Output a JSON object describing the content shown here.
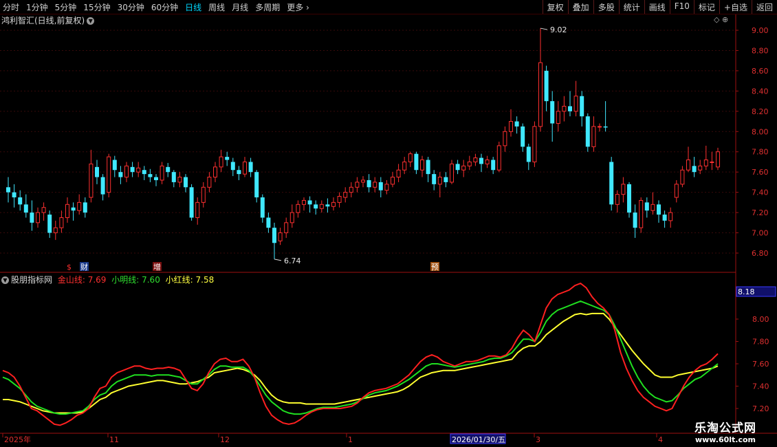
{
  "toolbar": {
    "periods": [
      "分时",
      "1分钟",
      "5分钟",
      "15分钟",
      "30分钟",
      "60分钟",
      "日线",
      "周线",
      "月线",
      "多周期",
      "更多"
    ],
    "active_period": "日线",
    "more_icon": "chevron-right-icon",
    "right_buttons": [
      "复权",
      "叠加",
      "多股",
      "统计",
      "画线",
      "F10",
      "标记",
      "+自选",
      "返回"
    ]
  },
  "stock": {
    "title": "鸿利智汇(日线,前复权)",
    "title_icon": "chevron-down-icon",
    "panel_icons": "◇ ⊕"
  },
  "indicator": {
    "icon": "chevron-down-icon",
    "name": "股朋指标网",
    "line1": "金山线: 7.69",
    "line2": "小明线: 7.60",
    "line3": "小红线: 7.58",
    "current_value": "8.18",
    "colors": {
      "jinshan": "#ff2020",
      "xiaoming": "#20e020",
      "xiaohong": "#ffff30"
    }
  },
  "chart_data": [
    {
      "type": "candlestick",
      "price_axis_ticks": [
        "9.00",
        "8.80",
        "8.60",
        "8.40",
        "8.20",
        "8.00",
        "7.80",
        "7.60",
        "7.40",
        "7.20",
        "7.00",
        "6.80"
      ],
      "ylim": [
        6.7,
        9.1
      ],
      "high_label": "9.02",
      "low_label": "6.74",
      "markers": [
        {
          "text": "$",
          "color": "#ff3030"
        },
        {
          "text": "财",
          "color": "#ffffff"
        },
        {
          "text": "增",
          "color": "#ffffff"
        },
        {
          "text": "预",
          "color": "#ffffff"
        }
      ],
      "colors": {
        "up": "#ff3030",
        "down": "#40e8ff"
      },
      "candles": [
        [
          7.45,
          7.4,
          7.55,
          7.3
        ],
        [
          7.4,
          7.35,
          7.48,
          7.25
        ],
        [
          7.35,
          7.28,
          7.42,
          7.22
        ],
        [
          7.28,
          7.2,
          7.38,
          7.15
        ],
        [
          7.2,
          7.1,
          7.32,
          7.02
        ],
        [
          7.1,
          7.2,
          7.25,
          7.05
        ],
        [
          7.2,
          7.25,
          7.3,
          7.12
        ],
        [
          7.18,
          7.0,
          7.22,
          6.95
        ],
        [
          7.0,
          7.05,
          7.12,
          6.93
        ],
        [
          7.05,
          7.15,
          7.22,
          7.0
        ],
        [
          7.15,
          7.28,
          7.35,
          7.1
        ],
        [
          7.25,
          7.22,
          7.3,
          7.12
        ],
        [
          7.22,
          7.3,
          7.38,
          7.18
        ],
        [
          7.3,
          7.2,
          7.35,
          7.15
        ],
        [
          7.35,
          7.68,
          7.82,
          7.3
        ],
        [
          7.65,
          7.55,
          7.72,
          7.48
        ],
        [
          7.55,
          7.38,
          7.58,
          7.32
        ],
        [
          7.4,
          7.75,
          7.78,
          7.35
        ],
        [
          7.72,
          7.62,
          7.76,
          7.55
        ],
        [
          7.6,
          7.55,
          7.66,
          7.48
        ],
        [
          7.55,
          7.66,
          7.7,
          7.5
        ],
        [
          7.65,
          7.6,
          7.7,
          7.55
        ],
        [
          7.6,
          7.64,
          7.7,
          7.55
        ],
        [
          7.62,
          7.58,
          7.66,
          7.52
        ],
        [
          7.58,
          7.55,
          7.63,
          7.5
        ],
        [
          7.55,
          7.52,
          7.58,
          7.46
        ],
        [
          7.52,
          7.66,
          7.7,
          7.48
        ],
        [
          7.65,
          7.6,
          7.69,
          7.55
        ],
        [
          7.6,
          7.5,
          7.62,
          7.45
        ],
        [
          7.5,
          7.55,
          7.6,
          7.45
        ],
        [
          7.55,
          7.45,
          7.58,
          7.4
        ],
        [
          7.45,
          7.15,
          7.48,
          7.12
        ],
        [
          7.15,
          7.3,
          7.35,
          7.08
        ],
        [
          7.3,
          7.45,
          7.5,
          7.25
        ],
        [
          7.45,
          7.55,
          7.6,
          7.4
        ],
        [
          7.55,
          7.65,
          7.7,
          7.5
        ],
        [
          7.65,
          7.75,
          7.82,
          7.6
        ],
        [
          7.75,
          7.72,
          7.8,
          7.66
        ],
        [
          7.7,
          7.62,
          7.74,
          7.56
        ],
        [
          7.62,
          7.58,
          7.66,
          7.52
        ],
        [
          7.58,
          7.7,
          7.75,
          7.55
        ],
        [
          7.7,
          7.6,
          7.74,
          7.55
        ],
        [
          7.6,
          7.35,
          7.62,
          7.3
        ],
        [
          7.35,
          7.15,
          7.38,
          7.1
        ],
        [
          7.15,
          7.05,
          7.2,
          7.0
        ],
        [
          7.05,
          6.9,
          7.1,
          6.74
        ],
        [
          6.92,
          7.0,
          7.05,
          6.88
        ],
        [
          7.0,
          7.1,
          7.15,
          6.95
        ],
        [
          7.1,
          7.2,
          7.28,
          7.05
        ],
        [
          7.2,
          7.28,
          7.32,
          7.15
        ],
        [
          7.28,
          7.32,
          7.35,
          7.22
        ],
        [
          7.32,
          7.28,
          7.36,
          7.2
        ],
        [
          7.28,
          7.24,
          7.32,
          7.18
        ],
        [
          7.24,
          7.28,
          7.32,
          7.2
        ],
        [
          7.28,
          7.26,
          7.34,
          7.2
        ],
        [
          7.26,
          7.3,
          7.35,
          7.22
        ],
        [
          7.3,
          7.36,
          7.4,
          7.25
        ],
        [
          7.35,
          7.4,
          7.45,
          7.3
        ],
        [
          7.4,
          7.45,
          7.5,
          7.35
        ],
        [
          7.45,
          7.5,
          7.55,
          7.4
        ],
        [
          7.5,
          7.52,
          7.56,
          7.45
        ],
        [
          7.52,
          7.45,
          7.58,
          7.4
        ],
        [
          7.45,
          7.5,
          7.55,
          7.4
        ],
        [
          7.5,
          7.42,
          7.55,
          7.35
        ],
        [
          7.42,
          7.48,
          7.52,
          7.38
        ],
        [
          7.48,
          7.55,
          7.6,
          7.45
        ],
        [
          7.55,
          7.62,
          7.68,
          7.5
        ],
        [
          7.62,
          7.7,
          7.75,
          7.58
        ],
        [
          7.7,
          7.78,
          7.8,
          7.65
        ],
        [
          7.78,
          7.62,
          7.8,
          7.58
        ],
        [
          7.62,
          7.72,
          7.76,
          7.55
        ],
        [
          7.72,
          7.58,
          7.75,
          7.5
        ],
        [
          7.58,
          7.48,
          7.62,
          7.42
        ],
        [
          7.48,
          7.55,
          7.6,
          7.35
        ],
        [
          7.55,
          7.5,
          7.6,
          7.45
        ],
        [
          7.5,
          7.68,
          7.72,
          7.48
        ],
        [
          7.68,
          7.62,
          7.72,
          7.58
        ],
        [
          7.62,
          7.66,
          7.72,
          7.55
        ],
        [
          7.66,
          7.7,
          7.76,
          7.62
        ],
        [
          7.7,
          7.74,
          7.78,
          7.66
        ],
        [
          7.74,
          7.68,
          7.78,
          7.6
        ],
        [
          7.68,
          7.72,
          7.76,
          7.64
        ],
        [
          7.72,
          7.62,
          7.75,
          7.58
        ],
        [
          7.62,
          7.86,
          7.9,
          7.6
        ],
        [
          7.86,
          8.0,
          8.05,
          7.8
        ],
        [
          8.0,
          8.1,
          8.22,
          7.95
        ],
        [
          8.1,
          8.05,
          8.15,
          7.98
        ],
        [
          8.05,
          7.85,
          8.08,
          7.8
        ],
        [
          7.85,
          7.7,
          7.88,
          7.62
        ],
        [
          7.7,
          8.05,
          8.1,
          7.65
        ],
        [
          8.05,
          8.68,
          9.02,
          8.0
        ],
        [
          8.6,
          8.3,
          8.65,
          8.2
        ],
        [
          8.3,
          8.08,
          8.4,
          7.9
        ],
        [
          8.08,
          8.2,
          8.3,
          8.0
        ],
        [
          8.2,
          8.25,
          8.35,
          8.1
        ],
        [
          8.25,
          8.2,
          8.4,
          8.15
        ],
        [
          8.2,
          8.35,
          8.5,
          8.15
        ],
        [
          8.35,
          8.15,
          8.4,
          8.05
        ],
        [
          8.15,
          7.85,
          8.18,
          7.8
        ],
        [
          7.85,
          8.05,
          8.15,
          7.8
        ],
        [
          8.05,
          8.05,
          8.08,
          8.0
        ],
        [
          8.05,
          8.04,
          8.3,
          8.0
        ],
        [
          7.7,
          7.28,
          7.75,
          7.22
        ],
        [
          7.28,
          7.38,
          7.42,
          7.2
        ],
        [
          7.38,
          7.48,
          7.55,
          7.3
        ],
        [
          7.48,
          7.2,
          7.5,
          7.15
        ],
        [
          7.2,
          7.05,
          7.28,
          6.95
        ],
        [
          7.05,
          7.32,
          7.35,
          7.0
        ],
        [
          7.3,
          7.22,
          7.35,
          7.15
        ],
        [
          7.22,
          7.28,
          7.4,
          7.18
        ],
        [
          7.28,
          7.18,
          7.32,
          7.1
        ],
        [
          7.18,
          7.12,
          7.22,
          7.05
        ],
        [
          7.12,
          7.2,
          7.25,
          7.05
        ],
        [
          7.35,
          7.48,
          7.52,
          7.3
        ],
        [
          7.48,
          7.62,
          7.66,
          7.45
        ],
        [
          7.62,
          7.72,
          7.85,
          7.6
        ],
        [
          7.66,
          7.6,
          7.75,
          7.55
        ],
        [
          7.62,
          7.66,
          7.72,
          7.58
        ],
        [
          7.66,
          7.72,
          7.86,
          7.62
        ],
        [
          7.7,
          7.7,
          7.8,
          7.62
        ],
        [
          7.65,
          7.8,
          7.84,
          7.62
        ]
      ]
    },
    {
      "type": "line",
      "y_axis_ticks": [
        "8.00",
        "7.80",
        "7.60",
        "7.40",
        "7.20"
      ],
      "ylim": [
        7.12,
        8.4
      ],
      "x_labels": [
        "2025年",
        "11",
        "12",
        "1",
        "2026/01/30/五",
        "3",
        "4"
      ],
      "series": [
        {
          "name": "金山线",
          "color": "#ff2020",
          "values": [
            7.54,
            7.52,
            7.48,
            7.4,
            7.3,
            7.2,
            7.18,
            7.14,
            7.1,
            7.06,
            7.05,
            7.07,
            7.1,
            7.14,
            7.16,
            7.2,
            7.3,
            7.38,
            7.4,
            7.48,
            7.52,
            7.54,
            7.56,
            7.58,
            7.58,
            7.56,
            7.55,
            7.56,
            7.56,
            7.57,
            7.56,
            7.54,
            7.46,
            7.38,
            7.36,
            7.42,
            7.52,
            7.6,
            7.64,
            7.65,
            7.62,
            7.62,
            7.64,
            7.58,
            7.48,
            7.34,
            7.22,
            7.14,
            7.1,
            7.07,
            7.06,
            7.07,
            7.1,
            7.14,
            7.17,
            7.19,
            7.2,
            7.2,
            7.2,
            7.2,
            7.21,
            7.22,
            7.25,
            7.3,
            7.34,
            7.36,
            7.37,
            7.38,
            7.4,
            7.42,
            7.46,
            7.5,
            7.56,
            7.62,
            7.66,
            7.68,
            7.66,
            7.62,
            7.6,
            7.58,
            7.6,
            7.62,
            7.62,
            7.63,
            7.65,
            7.67,
            7.67,
            7.66,
            7.68,
            7.74,
            7.83,
            7.9,
            7.86,
            7.8,
            7.95,
            8.1,
            8.18,
            8.22,
            8.24,
            8.26,
            8.3,
            8.32,
            8.28,
            8.2,
            8.14,
            8.1,
            8.04,
            7.9,
            7.7,
            7.56,
            7.45,
            7.36,
            7.3,
            7.26,
            7.22,
            7.2,
            7.18,
            7.2,
            7.3,
            7.4,
            7.48,
            7.54,
            7.58,
            7.6,
            7.64,
            7.69
          ]
        },
        {
          "name": "小明线",
          "color": "#20e020",
          "values": [
            7.48,
            7.46,
            7.42,
            7.38,
            7.32,
            7.26,
            7.22,
            7.2,
            7.18,
            7.16,
            7.15,
            7.15,
            7.16,
            7.17,
            7.18,
            7.22,
            7.28,
            7.32,
            7.34,
            7.4,
            7.44,
            7.46,
            7.48,
            7.5,
            7.5,
            7.5,
            7.49,
            7.5,
            7.5,
            7.5,
            7.49,
            7.48,
            7.45,
            7.42,
            7.42,
            7.46,
            7.5,
            7.55,
            7.58,
            7.58,
            7.57,
            7.57,
            7.57,
            7.54,
            7.48,
            7.4,
            7.32,
            7.26,
            7.22,
            7.18,
            7.16,
            7.15,
            7.15,
            7.16,
            7.18,
            7.2,
            7.21,
            7.21,
            7.21,
            7.22,
            7.23,
            7.24,
            7.26,
            7.29,
            7.32,
            7.34,
            7.35,
            7.36,
            7.38,
            7.4,
            7.43,
            7.46,
            7.5,
            7.54,
            7.58,
            7.6,
            7.6,
            7.59,
            7.58,
            7.57,
            7.58,
            7.59,
            7.6,
            7.61,
            7.62,
            7.64,
            7.65,
            7.65,
            7.67,
            7.7,
            7.76,
            7.82,
            7.82,
            7.8,
            7.88,
            7.98,
            8.04,
            8.08,
            8.1,
            8.12,
            8.14,
            8.16,
            8.14,
            8.12,
            8.1,
            8.08,
            8.04,
            7.94,
            7.82,
            7.7,
            7.58,
            7.48,
            7.4,
            7.34,
            7.3,
            7.28,
            7.26,
            7.27,
            7.32,
            7.38,
            7.42,
            7.46,
            7.48,
            7.52,
            7.56,
            7.6
          ]
        },
        {
          "name": "小红线",
          "color": "#ffff30",
          "values": [
            7.28,
            7.28,
            7.27,
            7.26,
            7.24,
            7.22,
            7.2,
            7.18,
            7.17,
            7.16,
            7.16,
            7.16,
            7.16,
            7.16,
            7.17,
            7.2,
            7.24,
            7.28,
            7.3,
            7.34,
            7.36,
            7.38,
            7.4,
            7.41,
            7.42,
            7.43,
            7.44,
            7.45,
            7.45,
            7.44,
            7.43,
            7.42,
            7.42,
            7.43,
            7.44,
            7.46,
            7.48,
            7.52,
            7.53,
            7.54,
            7.55,
            7.56,
            7.55,
            7.53,
            7.5,
            7.45,
            7.38,
            7.32,
            7.28,
            7.26,
            7.25,
            7.25,
            7.25,
            7.24,
            7.24,
            7.24,
            7.24,
            7.24,
            7.24,
            7.25,
            7.26,
            7.27,
            7.28,
            7.29,
            7.3,
            7.31,
            7.32,
            7.33,
            7.34,
            7.35,
            7.37,
            7.4,
            7.44,
            7.48,
            7.5,
            7.52,
            7.53,
            7.54,
            7.54,
            7.54,
            7.55,
            7.56,
            7.57,
            7.58,
            7.59,
            7.6,
            7.61,
            7.62,
            7.63,
            7.64,
            7.7,
            7.74,
            7.76,
            7.76,
            7.8,
            7.86,
            7.9,
            7.94,
            7.98,
            8.01,
            8.04,
            8.05,
            8.04,
            8.05,
            8.05,
            8.05,
            8.0,
            7.93,
            7.86,
            7.79,
            7.72,
            7.66,
            7.6,
            7.55,
            7.5,
            7.48,
            7.48,
            7.48,
            7.5,
            7.51,
            7.52,
            7.53,
            7.54,
            7.55,
            7.56,
            7.58
          ]
        }
      ]
    }
  ]
}
